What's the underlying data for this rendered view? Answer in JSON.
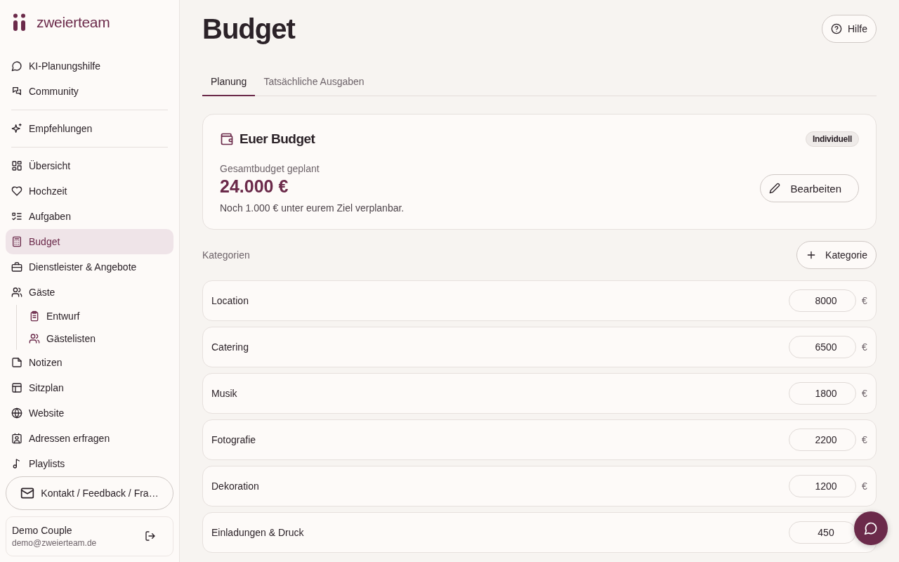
{
  "sidebar": {
    "logo": "zweierteam",
    "items": [
      {
        "kind": "item",
        "label": "KI-Planungshilfe",
        "selected": false
      },
      {
        "kind": "item",
        "label": "Community",
        "selected": false
      },
      {
        "kind": "divider"
      },
      {
        "kind": "item",
        "label": "Empfehlungen",
        "selected": false
      },
      {
        "kind": "divider"
      },
      {
        "kind": "item",
        "label": "Übersicht",
        "selected": false
      },
      {
        "kind": "item",
        "label": "Hochzeit",
        "selected": false
      },
      {
        "kind": "item",
        "label": "Aufgaben",
        "selected": false
      },
      {
        "kind": "item",
        "label": "Budget",
        "selected": true
      },
      {
        "kind": "item",
        "label": "Dienstleister & Angebote",
        "selected": false
      },
      {
        "kind": "item",
        "label": "Gäste",
        "selected": false,
        "children": [
          {
            "label": "Entwurf",
            "selected": false
          },
          {
            "label": "Gästelisten",
            "selected": false
          }
        ]
      },
      {
        "kind": "item",
        "label": "Notizen",
        "selected": false
      },
      {
        "kind": "item",
        "label": "Sitzplan",
        "selected": false
      },
      {
        "kind": "item",
        "label": "Website",
        "selected": false
      },
      {
        "kind": "item",
        "label": "Adressen erfragen",
        "selected": false
      },
      {
        "kind": "item",
        "label": "Playlists",
        "selected": false
      }
    ],
    "contact_button": "Kontakt / Feedback / Fra…",
    "user": {
      "name": "Demo Couple",
      "email": "demo@zweierteam.de"
    }
  },
  "header": {
    "title": "Budget",
    "help_button": "Hilfe"
  },
  "tabs": [
    {
      "label": "Planung",
      "selected": true
    },
    {
      "label": "Tatsächliche Ausgaben",
      "selected": false
    }
  ],
  "budget_card": {
    "title": "Euer Budget",
    "badge": "Individuell",
    "label": "Gesamtbudget geplant",
    "amount": "24.000 €",
    "note": "Noch 1.000 € unter eurem Ziel verplanbar.",
    "edit_button": "Bearbeiten"
  },
  "categories": {
    "heading": "Kategorien",
    "add_button": "Kategorie",
    "rows": [
      {
        "name": "Location",
        "value": "8000",
        "currency": "€"
      },
      {
        "name": "Catering",
        "value": "6500",
        "currency": "€"
      },
      {
        "name": "Musik",
        "value": "1800",
        "currency": "€"
      },
      {
        "name": "Fotografie",
        "value": "2200",
        "currency": "€"
      },
      {
        "name": "Dekoration",
        "value": "1200",
        "currency": "€"
      },
      {
        "name": "Einladungen & Druck",
        "value": "450"
      }
    ]
  }
}
